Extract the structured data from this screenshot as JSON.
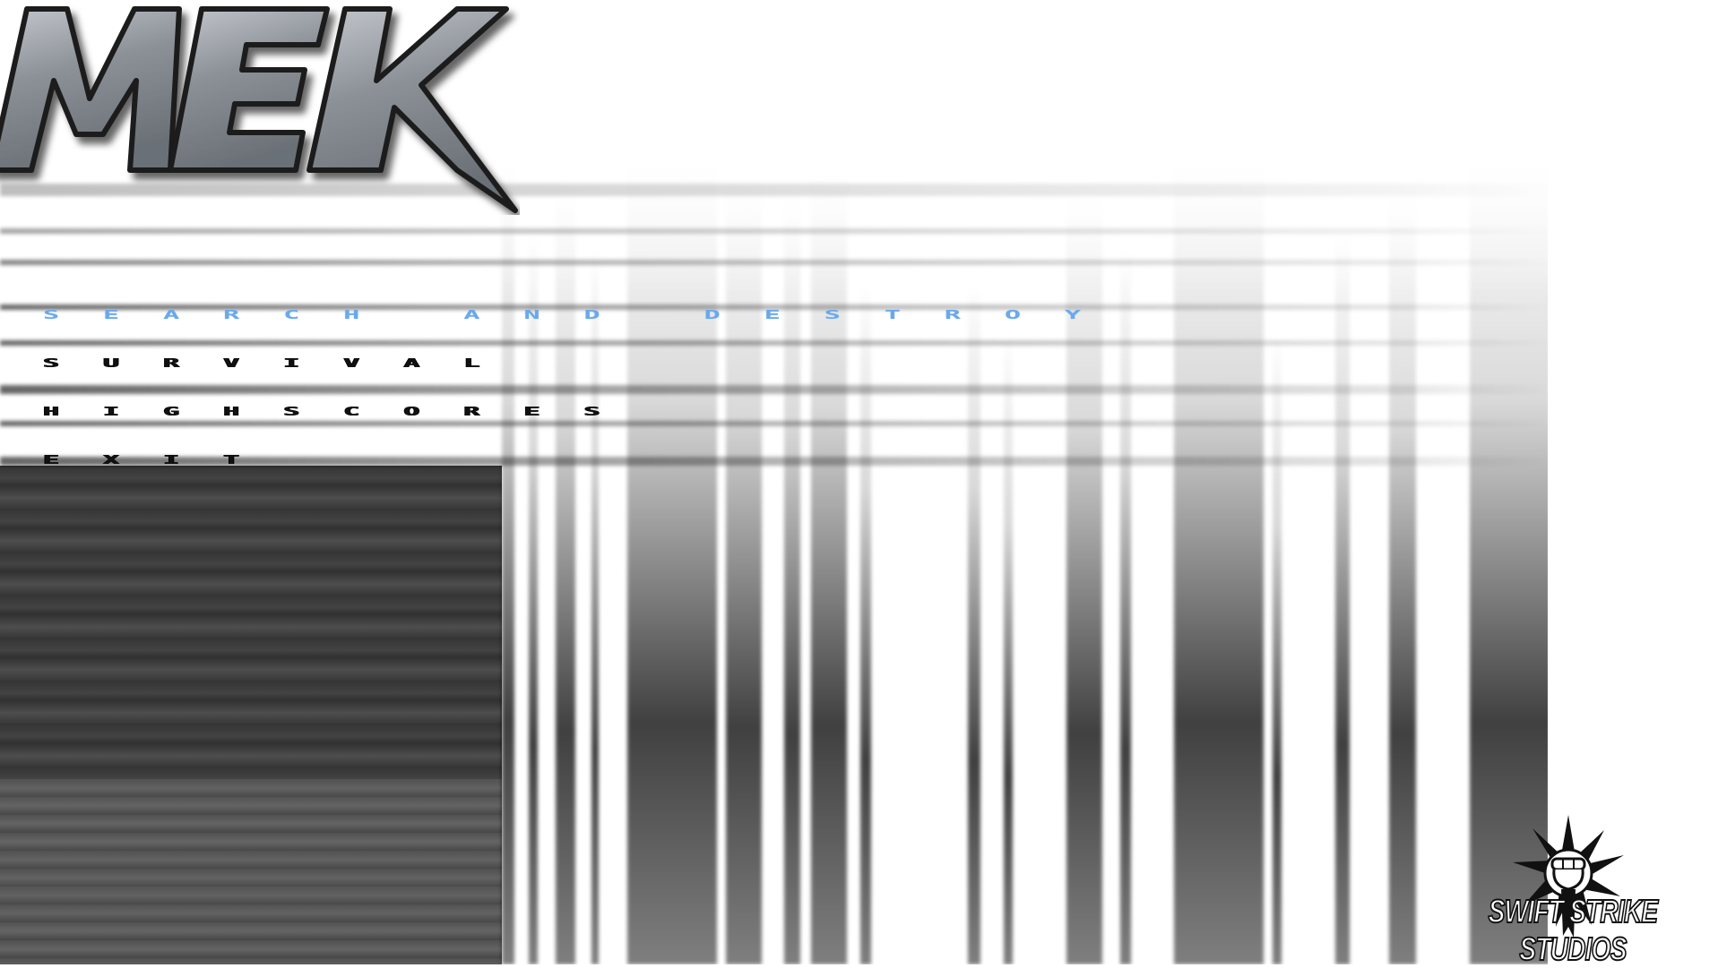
{
  "game": {
    "title": "MEK"
  },
  "menu": {
    "items": [
      {
        "label": "SEARCH AND DESTROY",
        "selected": true
      },
      {
        "label": "SURVIVAL",
        "selected": false
      },
      {
        "label": "HIGHSCORES",
        "selected": false
      },
      {
        "label": "EXIT",
        "selected": false
      }
    ]
  },
  "studio": {
    "name": "SWIFT STRIKE STUDIOS",
    "icon": "raised-fist-starburst-icon"
  },
  "colors": {
    "selected_item": "#6aa8ea",
    "menu_text": "#111111",
    "logo_metal": "#8c9198",
    "logo_outline": "#1a1a1a",
    "background": "#ffffff"
  }
}
